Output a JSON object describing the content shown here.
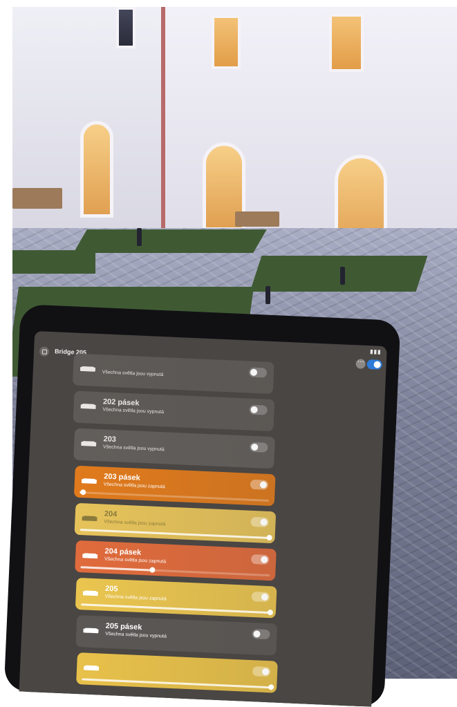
{
  "app": {
    "header": {
      "title": "Bridge 205"
    }
  },
  "rooms": [
    {
      "name": "",
      "status": "Všechna světla jsou vypnutá",
      "on": false,
      "brightness": 0,
      "color": "#5e5a57",
      "text_color": "#e9e6e3"
    },
    {
      "name": "202 pásek",
      "status": "Všechna světla jsou vypnutá",
      "on": false,
      "brightness": 0,
      "color": "#5e5a57",
      "text_color": "#e9e6e3"
    },
    {
      "name": "203",
      "status": "Všechna světla jsou vypnutá",
      "on": false,
      "brightness": 0,
      "color": "#625e5b",
      "text_color": "#e9e6e3"
    },
    {
      "name": "203 pásek",
      "status": "Všechna světla jsou zapnutá",
      "on": true,
      "brightness": 0.02,
      "color": "#e07a1c",
      "text_color": "#ffffff"
    },
    {
      "name": "204",
      "status": "Všechna světla jsou zapnutá",
      "on": true,
      "brightness": 1.0,
      "color": "#e6c35a",
      "text_color": "#8a7a3c"
    },
    {
      "name": "204 pásek",
      "status": "Všechna světla jsou zapnutá",
      "on": true,
      "brightness": 0.38,
      "color": "#e06b3c",
      "text_color": "#ffffff"
    },
    {
      "name": "205",
      "status": "Všechna světla jsou zapnutá",
      "on": true,
      "brightness": 1.0,
      "color": "#eac54f",
      "text_color": "#ffffff"
    },
    {
      "name": "205 pásek",
      "status": "Všechna světla jsou vypnutá",
      "on": false,
      "brightness": 0,
      "color": "#5b5754",
      "text_color": "#ffffff"
    },
    {
      "name": "",
      "status": "",
      "on": true,
      "brightness": 1.0,
      "color": "#e8c14a",
      "text_color": "#ffffff"
    }
  ],
  "icons": {
    "room": "sofa-icon",
    "home": "grid-icon",
    "more": "ellipsis-icon"
  },
  "colors": {
    "toggle_on": "#2e7bd8"
  }
}
